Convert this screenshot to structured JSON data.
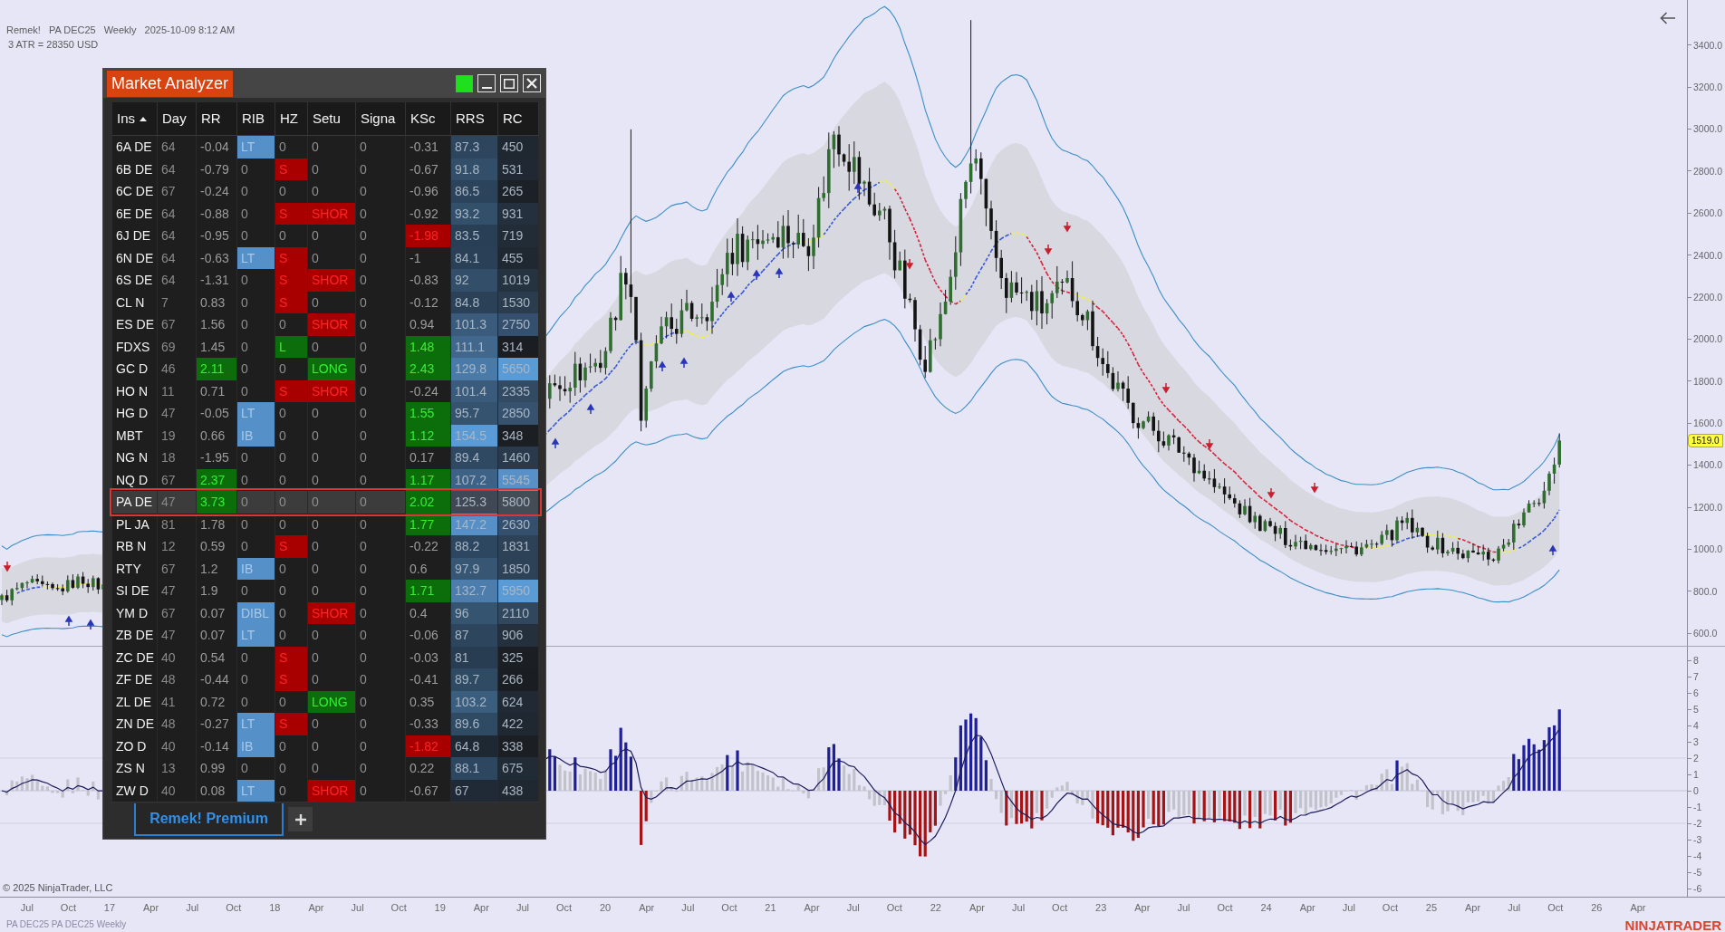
{
  "chart_header": {
    "parts": [
      "Remek!",
      "PA DEC25",
      "Weekly",
      "2025-10-09 8:12 AM"
    ],
    "atr": "3 ATR = 28350 USD"
  },
  "price_axis": {
    "labels": [
      "3400.0",
      "3200.0",
      "3000.0",
      "2800.0",
      "2600.0",
      "2400.0",
      "2200.0",
      "2000.0",
      "1800.0",
      "1600.0",
      "1400.0",
      "1200.0",
      "1000.0",
      "800.0",
      "600.0"
    ],
    "last_price": "1519.0"
  },
  "oscillator_axis": {
    "labels": [
      "8",
      "7",
      "6",
      "5",
      "4",
      "3",
      "2",
      "1",
      "0",
      "-1",
      "-2",
      "-3",
      "-4",
      "-5",
      "-6"
    ]
  },
  "time_axis": {
    "labels": [
      "Jul",
      "Oct",
      "17",
      "Apr",
      "Jul",
      "Oct",
      "18",
      "Apr",
      "Jul",
      "Oct",
      "19",
      "Apr",
      "Jul",
      "Oct",
      "20",
      "Apr",
      "Jul",
      "Oct",
      "21",
      "Apr",
      "Jul",
      "Oct",
      "22",
      "Apr",
      "Jul",
      "Oct",
      "23",
      "Apr",
      "Jul",
      "Oct",
      "24",
      "Apr",
      "Jul",
      "Oct",
      "25",
      "Apr",
      "Jul",
      "Oct",
      "26",
      "Apr"
    ]
  },
  "copyright": "© 2025 NinjaTrader, LLC",
  "chart_caption": "PA DEC25 PA DEC25 Weekly",
  "logo": "NINJATRADER",
  "market_analyzer": {
    "title": "Market Analyzer",
    "columns": [
      {
        "label": "Ins",
        "sorted": true
      },
      {
        "label": "Day",
        "sorted": false
      },
      {
        "label": "RR",
        "sorted": false
      },
      {
        "label": "RIB",
        "sorted": false
      },
      {
        "label": "HZ",
        "sorted": false
      },
      {
        "label": "Setu",
        "sorted": false
      },
      {
        "label": "Signa",
        "sorted": false
      },
      {
        "label": "KSc",
        "sorted": false
      },
      {
        "label": "RRS",
        "sorted": false
      },
      {
        "label": "RC",
        "sorted": false
      }
    ],
    "rows": [
      {
        "selected": false,
        "cells": [
          {
            "text": "6A DE",
            "kind": "plain"
          },
          {
            "text": "64",
            "kind": "plain"
          },
          {
            "text": "-0.04",
            "kind": "plain"
          },
          {
            "text": "LT",
            "kind": "band"
          },
          {
            "text": "0",
            "kind": "plain"
          },
          {
            "text": "0",
            "kind": "plain"
          },
          {
            "text": "0",
            "kind": "plain"
          },
          {
            "text": "-0.31",
            "kind": "plain"
          },
          {
            "text": "87.3",
            "kind": "heat",
            "color": "#2d455d"
          },
          {
            "text": "450",
            "kind": "heat",
            "color": "#1f2731"
          }
        ]
      },
      {
        "selected": false,
        "cells": [
          {
            "text": "6B DE",
            "kind": "plain"
          },
          {
            "text": "64",
            "kind": "plain"
          },
          {
            "text": "-0.79",
            "kind": "plain"
          },
          {
            "text": "0",
            "kind": "plain"
          },
          {
            "text": "S",
            "kind": "short"
          },
          {
            "text": "0",
            "kind": "plain"
          },
          {
            "text": "0",
            "kind": "plain"
          },
          {
            "text": "-0.67",
            "kind": "plain"
          },
          {
            "text": "91.8",
            "kind": "heat",
            "color": "#324e69"
          },
          {
            "text": "531",
            "kind": "heat",
            "color": "#202933"
          }
        ]
      },
      {
        "selected": false,
        "cells": [
          {
            "text": "6C DE",
            "kind": "plain"
          },
          {
            "text": "67",
            "kind": "plain"
          },
          {
            "text": "-0.24",
            "kind": "plain"
          },
          {
            "text": "0",
            "kind": "plain"
          },
          {
            "text": "0",
            "kind": "plain"
          },
          {
            "text": "0",
            "kind": "plain"
          },
          {
            "text": "0",
            "kind": "plain"
          },
          {
            "text": "-0.96",
            "kind": "plain"
          },
          {
            "text": "86.5",
            "kind": "heat",
            "color": "#2c445b"
          },
          {
            "text": "265",
            "kind": "heat",
            "color": "#1c2128"
          }
        ]
      },
      {
        "selected": false,
        "cells": [
          {
            "text": "6E DE",
            "kind": "plain"
          },
          {
            "text": "64",
            "kind": "plain"
          },
          {
            "text": "-0.88",
            "kind": "plain"
          },
          {
            "text": "0",
            "kind": "plain"
          },
          {
            "text": "S",
            "kind": "short"
          },
          {
            "text": "SHOR",
            "kind": "short"
          },
          {
            "text": "0",
            "kind": "plain"
          },
          {
            "text": "-0.92",
            "kind": "plain"
          },
          {
            "text": "93.2",
            "kind": "heat",
            "color": "#33506b"
          },
          {
            "text": "931",
            "kind": "heat",
            "color": "#24303d"
          }
        ]
      },
      {
        "selected": false,
        "cells": [
          {
            "text": "6J DE",
            "kind": "plain"
          },
          {
            "text": "64",
            "kind": "plain"
          },
          {
            "text": "-0.95",
            "kind": "plain"
          },
          {
            "text": "0",
            "kind": "plain"
          },
          {
            "text": "0",
            "kind": "plain"
          },
          {
            "text": "0",
            "kind": "plain"
          },
          {
            "text": "0",
            "kind": "plain"
          },
          {
            "text": "-1.98",
            "kind": "short"
          },
          {
            "text": "83.5",
            "kind": "heat",
            "color": "#293f55"
          },
          {
            "text": "719",
            "kind": "heat",
            "color": "#222c37"
          }
        ]
      },
      {
        "selected": false,
        "cells": [
          {
            "text": "6N DE",
            "kind": "plain"
          },
          {
            "text": "64",
            "kind": "plain"
          },
          {
            "text": "-0.63",
            "kind": "plain"
          },
          {
            "text": "LT",
            "kind": "band"
          },
          {
            "text": "S",
            "kind": "short"
          },
          {
            "text": "0",
            "kind": "plain"
          },
          {
            "text": "0",
            "kind": "plain"
          },
          {
            "text": "-1",
            "kind": "plain"
          },
          {
            "text": "84.1",
            "kind": "heat",
            "color": "#2a4056"
          },
          {
            "text": "455",
            "kind": "heat",
            "color": "#1f2731"
          }
        ]
      },
      {
        "selected": false,
        "cells": [
          {
            "text": "6S DE",
            "kind": "plain"
          },
          {
            "text": "64",
            "kind": "plain"
          },
          {
            "text": "-1.31",
            "kind": "plain"
          },
          {
            "text": "0",
            "kind": "plain"
          },
          {
            "text": "S",
            "kind": "short"
          },
          {
            "text": "SHOR",
            "kind": "short"
          },
          {
            "text": "0",
            "kind": "plain"
          },
          {
            "text": "-0.83",
            "kind": "plain"
          },
          {
            "text": "92",
            "kind": "heat",
            "color": "#324e69"
          },
          {
            "text": "1019",
            "kind": "heat",
            "color": "#25323f"
          }
        ]
      },
      {
        "selected": false,
        "cells": [
          {
            "text": "CL N",
            "kind": "plain"
          },
          {
            "text": "7",
            "kind": "plain"
          },
          {
            "text": "0.83",
            "kind": "plain"
          },
          {
            "text": "0",
            "kind": "plain"
          },
          {
            "text": "S",
            "kind": "short"
          },
          {
            "text": "0",
            "kind": "plain"
          },
          {
            "text": "0",
            "kind": "plain"
          },
          {
            "text": "-0.12",
            "kind": "plain"
          },
          {
            "text": "84.8",
            "kind": "heat",
            "color": "#2a4157"
          },
          {
            "text": "1530",
            "kind": "heat",
            "color": "#2b3c4e"
          }
        ]
      },
      {
        "selected": false,
        "cells": [
          {
            "text": "ES DE",
            "kind": "plain"
          },
          {
            "text": "67",
            "kind": "plain"
          },
          {
            "text": "1.56",
            "kind": "plain"
          },
          {
            "text": "0",
            "kind": "plain"
          },
          {
            "text": "0",
            "kind": "plain"
          },
          {
            "text": "SHOR",
            "kind": "short"
          },
          {
            "text": "0",
            "kind": "plain"
          },
          {
            "text": "0.94",
            "kind": "plain"
          },
          {
            "text": "101.3",
            "kind": "heat",
            "color": "#3a5b7b"
          },
          {
            "text": "2750",
            "kind": "heat",
            "color": "#34506e"
          }
        ]
      },
      {
        "selected": false,
        "cells": [
          {
            "text": "FDXS",
            "kind": "plain"
          },
          {
            "text": "69",
            "kind": "plain"
          },
          {
            "text": "1.45",
            "kind": "plain"
          },
          {
            "text": "0",
            "kind": "plain"
          },
          {
            "text": "L",
            "kind": "long"
          },
          {
            "text": "0",
            "kind": "plain"
          },
          {
            "text": "0",
            "kind": "plain"
          },
          {
            "text": "1.48",
            "kind": "long"
          },
          {
            "text": "111.1",
            "kind": "heat",
            "color": "#41678d"
          },
          {
            "text": "314",
            "kind": "heat",
            "color": "#1a1d21"
          }
        ]
      },
      {
        "selected": false,
        "cells": [
          {
            "text": "GC D",
            "kind": "plain"
          },
          {
            "text": "46",
            "kind": "plain"
          },
          {
            "text": "2.11",
            "kind": "long"
          },
          {
            "text": "0",
            "kind": "plain"
          },
          {
            "text": "0",
            "kind": "plain"
          },
          {
            "text": "LONG",
            "kind": "long"
          },
          {
            "text": "0",
            "kind": "plain"
          },
          {
            "text": "2.43",
            "kind": "long"
          },
          {
            "text": "129.8",
            "kind": "heat",
            "color": "#4a7aa8"
          },
          {
            "text": "5650",
            "kind": "heat",
            "color": "#5b9bd5"
          }
        ]
      },
      {
        "selected": false,
        "cells": [
          {
            "text": "HO N",
            "kind": "plain"
          },
          {
            "text": "11",
            "kind": "plain"
          },
          {
            "text": "0.71",
            "kind": "plain"
          },
          {
            "text": "0",
            "kind": "plain"
          },
          {
            "text": "S",
            "kind": "short"
          },
          {
            "text": "SHOR",
            "kind": "short"
          },
          {
            "text": "0",
            "kind": "plain"
          },
          {
            "text": "-0.24",
            "kind": "plain"
          },
          {
            "text": "101.4",
            "kind": "heat",
            "color": "#3a5b7b"
          },
          {
            "text": "2335",
            "kind": "heat",
            "color": "#324a62"
          }
        ]
      },
      {
        "selected": false,
        "cells": [
          {
            "text": "HG D",
            "kind": "plain"
          },
          {
            "text": "47",
            "kind": "plain"
          },
          {
            "text": "-0.05",
            "kind": "plain"
          },
          {
            "text": "LT",
            "kind": "band"
          },
          {
            "text": "0",
            "kind": "plain"
          },
          {
            "text": "0",
            "kind": "plain"
          },
          {
            "text": "0",
            "kind": "plain"
          },
          {
            "text": "1.55",
            "kind": "long"
          },
          {
            "text": "95.7",
            "kind": "heat",
            "color": "#35536f"
          },
          {
            "text": "2850",
            "kind": "heat",
            "color": "#36526f"
          }
        ]
      },
      {
        "selected": false,
        "cells": [
          {
            "text": "MBT",
            "kind": "plain"
          },
          {
            "text": "19",
            "kind": "plain"
          },
          {
            "text": "0.66",
            "kind": "plain"
          },
          {
            "text": "IB",
            "kind": "band"
          },
          {
            "text": "0",
            "kind": "plain"
          },
          {
            "text": "0",
            "kind": "plain"
          },
          {
            "text": "0",
            "kind": "plain"
          },
          {
            "text": "1.12",
            "kind": "long"
          },
          {
            "text": "154.5",
            "kind": "heat",
            "color": "#5b9bd5"
          },
          {
            "text": "348",
            "kind": "heat",
            "color": "#1b1e22"
          }
        ]
      },
      {
        "selected": false,
        "cells": [
          {
            "text": "NG N",
            "kind": "plain"
          },
          {
            "text": "18",
            "kind": "plain"
          },
          {
            "text": "-1.95",
            "kind": "plain"
          },
          {
            "text": "0",
            "kind": "plain"
          },
          {
            "text": "0",
            "kind": "plain"
          },
          {
            "text": "0",
            "kind": "plain"
          },
          {
            "text": "0",
            "kind": "plain"
          },
          {
            "text": "0.17",
            "kind": "plain"
          },
          {
            "text": "89.4",
            "kind": "heat",
            "color": "#2f4962"
          },
          {
            "text": "1460",
            "kind": "heat",
            "color": "#2a3a4c"
          }
        ]
      },
      {
        "selected": false,
        "cells": [
          {
            "text": "NQ D",
            "kind": "plain"
          },
          {
            "text": "67",
            "kind": "plain"
          },
          {
            "text": "2.37",
            "kind": "long"
          },
          {
            "text": "0",
            "kind": "plain"
          },
          {
            "text": "0",
            "kind": "plain"
          },
          {
            "text": "0",
            "kind": "plain"
          },
          {
            "text": "0",
            "kind": "plain"
          },
          {
            "text": "1.17",
            "kind": "long"
          },
          {
            "text": "107.2",
            "kind": "heat",
            "color": "#3e6286"
          },
          {
            "text": "5545",
            "kind": "heat",
            "color": "#5890c8"
          }
        ]
      },
      {
        "selected": true,
        "cells": [
          {
            "text": "PA DE",
            "kind": "plain"
          },
          {
            "text": "47",
            "kind": "plain"
          },
          {
            "text": "3.73",
            "kind": "long"
          },
          {
            "text": "0",
            "kind": "plain"
          },
          {
            "text": "0",
            "kind": "plain"
          },
          {
            "text": "0",
            "kind": "plain"
          },
          {
            "text": "0",
            "kind": "plain"
          },
          {
            "text": "2.02",
            "kind": "long"
          },
          {
            "text": "125.3",
            "kind": "heat",
            "color": "#3f4854"
          },
          {
            "text": "5800",
            "kind": "heat",
            "color": "#444c56"
          }
        ]
      },
      {
        "selected": false,
        "cells": [
          {
            "text": "PL JA",
            "kind": "plain"
          },
          {
            "text": "81",
            "kind": "plain"
          },
          {
            "text": "1.78",
            "kind": "plain"
          },
          {
            "text": "0",
            "kind": "plain"
          },
          {
            "text": "0",
            "kind": "plain"
          },
          {
            "text": "0",
            "kind": "plain"
          },
          {
            "text": "0",
            "kind": "plain"
          },
          {
            "text": "1.77",
            "kind": "long"
          },
          {
            "text": "147.2",
            "kind": "heat",
            "color": "#5690c6"
          },
          {
            "text": "2630",
            "kind": "heat",
            "color": "#34506c"
          }
        ]
      },
      {
        "selected": false,
        "cells": [
          {
            "text": "RB N",
            "kind": "plain"
          },
          {
            "text": "12",
            "kind": "plain"
          },
          {
            "text": "0.59",
            "kind": "plain"
          },
          {
            "text": "0",
            "kind": "plain"
          },
          {
            "text": "S",
            "kind": "short"
          },
          {
            "text": "0",
            "kind": "plain"
          },
          {
            "text": "0",
            "kind": "plain"
          },
          {
            "text": "-0.22",
            "kind": "plain"
          },
          {
            "text": "88.2",
            "kind": "heat",
            "color": "#2e4760"
          },
          {
            "text": "1831",
            "kind": "heat",
            "color": "#2d4256"
          }
        ]
      },
      {
        "selected": false,
        "cells": [
          {
            "text": "RTY",
            "kind": "plain"
          },
          {
            "text": "67",
            "kind": "plain"
          },
          {
            "text": "1.2",
            "kind": "plain"
          },
          {
            "text": "IB",
            "kind": "band"
          },
          {
            "text": "0",
            "kind": "plain"
          },
          {
            "text": "0",
            "kind": "plain"
          },
          {
            "text": "0",
            "kind": "plain"
          },
          {
            "text": "0.6",
            "kind": "plain"
          },
          {
            "text": "97.9",
            "kind": "heat",
            "color": "#365674"
          },
          {
            "text": "1850",
            "kind": "heat",
            "color": "#2d4256"
          }
        ]
      },
      {
        "selected": false,
        "cells": [
          {
            "text": "SI DE",
            "kind": "plain"
          },
          {
            "text": "47",
            "kind": "plain"
          },
          {
            "text": "1.9",
            "kind": "plain"
          },
          {
            "text": "0",
            "kind": "plain"
          },
          {
            "text": "0",
            "kind": "plain"
          },
          {
            "text": "0",
            "kind": "plain"
          },
          {
            "text": "0",
            "kind": "plain"
          },
          {
            "text": "1.71",
            "kind": "long"
          },
          {
            "text": "132.7",
            "kind": "heat",
            "color": "#4c7dad"
          },
          {
            "text": "5950",
            "kind": "heat",
            "color": "#5b9bd5"
          }
        ]
      },
      {
        "selected": false,
        "cells": [
          {
            "text": "YM D",
            "kind": "plain"
          },
          {
            "text": "67",
            "kind": "plain"
          },
          {
            "text": "0.07",
            "kind": "plain"
          },
          {
            "text": "DIBL",
            "kind": "band"
          },
          {
            "text": "0",
            "kind": "plain"
          },
          {
            "text": "SHOR",
            "kind": "short"
          },
          {
            "text": "0",
            "kind": "plain"
          },
          {
            "text": "0.4",
            "kind": "plain"
          },
          {
            "text": "96",
            "kind": "heat",
            "color": "#355470"
          },
          {
            "text": "2110",
            "kind": "heat",
            "color": "#30475e"
          }
        ]
      },
      {
        "selected": false,
        "cells": [
          {
            "text": "ZB DE",
            "kind": "plain"
          },
          {
            "text": "47",
            "kind": "plain"
          },
          {
            "text": "0.07",
            "kind": "plain"
          },
          {
            "text": "LT",
            "kind": "band"
          },
          {
            "text": "0",
            "kind": "plain"
          },
          {
            "text": "0",
            "kind": "plain"
          },
          {
            "text": "0",
            "kind": "plain"
          },
          {
            "text": "-0.06",
            "kind": "plain"
          },
          {
            "text": "87",
            "kind": "heat",
            "color": "#2d455d"
          },
          {
            "text": "906",
            "kind": "heat",
            "color": "#24303c"
          }
        ]
      },
      {
        "selected": false,
        "cells": [
          {
            "text": "ZC DE",
            "kind": "plain"
          },
          {
            "text": "40",
            "kind": "plain"
          },
          {
            "text": "0.54",
            "kind": "plain"
          },
          {
            "text": "0",
            "kind": "plain"
          },
          {
            "text": "S",
            "kind": "short"
          },
          {
            "text": "0",
            "kind": "plain"
          },
          {
            "text": "0",
            "kind": "plain"
          },
          {
            "text": "-0.03",
            "kind": "plain"
          },
          {
            "text": "81",
            "kind": "heat",
            "color": "#283d52"
          },
          {
            "text": "325",
            "kind": "heat",
            "color": "#1b1f24"
          }
        ]
      },
      {
        "selected": false,
        "cells": [
          {
            "text": "ZF DE",
            "kind": "plain"
          },
          {
            "text": "48",
            "kind": "plain"
          },
          {
            "text": "-0.44",
            "kind": "plain"
          },
          {
            "text": "0",
            "kind": "plain"
          },
          {
            "text": "S",
            "kind": "short"
          },
          {
            "text": "0",
            "kind": "plain"
          },
          {
            "text": "0",
            "kind": "plain"
          },
          {
            "text": "-0.41",
            "kind": "plain"
          },
          {
            "text": "89.7",
            "kind": "heat",
            "color": "#2f4a63"
          },
          {
            "text": "266",
            "kind": "heat",
            "color": "#1a1e22"
          }
        ]
      },
      {
        "selected": false,
        "cells": [
          {
            "text": "ZL DE",
            "kind": "plain"
          },
          {
            "text": "41",
            "kind": "plain"
          },
          {
            "text": "0.72",
            "kind": "plain"
          },
          {
            "text": "0",
            "kind": "plain"
          },
          {
            "text": "0",
            "kind": "plain"
          },
          {
            "text": "LONG",
            "kind": "long"
          },
          {
            "text": "0",
            "kind": "plain"
          },
          {
            "text": "0.35",
            "kind": "plain"
          },
          {
            "text": "103.2",
            "kind": "heat",
            "color": "#3b5d7e"
          },
          {
            "text": "624",
            "kind": "heat",
            "color": "#212a34"
          }
        ]
      },
      {
        "selected": false,
        "cells": [
          {
            "text": "ZN DE",
            "kind": "plain"
          },
          {
            "text": "48",
            "kind": "plain"
          },
          {
            "text": "-0.27",
            "kind": "plain"
          },
          {
            "text": "LT",
            "kind": "band"
          },
          {
            "text": "S",
            "kind": "short"
          },
          {
            "text": "0",
            "kind": "plain"
          },
          {
            "text": "0",
            "kind": "plain"
          },
          {
            "text": "-0.33",
            "kind": "plain"
          },
          {
            "text": "89.6",
            "kind": "heat",
            "color": "#2f4a63"
          },
          {
            "text": "422",
            "kind": "heat",
            "color": "#1f2731"
          }
        ]
      },
      {
        "selected": false,
        "cells": [
          {
            "text": "ZO D",
            "kind": "plain"
          },
          {
            "text": "40",
            "kind": "plain"
          },
          {
            "text": "-0.14",
            "kind": "plain"
          },
          {
            "text": "IB",
            "kind": "band"
          },
          {
            "text": "0",
            "kind": "plain"
          },
          {
            "text": "0",
            "kind": "plain"
          },
          {
            "text": "0",
            "kind": "plain"
          },
          {
            "text": "-1.82",
            "kind": "short"
          },
          {
            "text": "64.8",
            "kind": "heat",
            "color": "#1e2833"
          },
          {
            "text": "338",
            "kind": "heat",
            "color": "#1b1f24"
          }
        ]
      },
      {
        "selected": false,
        "cells": [
          {
            "text": "ZS N",
            "kind": "plain"
          },
          {
            "text": "13",
            "kind": "plain"
          },
          {
            "text": "0.99",
            "kind": "plain"
          },
          {
            "text": "0",
            "kind": "plain"
          },
          {
            "text": "0",
            "kind": "plain"
          },
          {
            "text": "0",
            "kind": "plain"
          },
          {
            "text": "0",
            "kind": "plain"
          },
          {
            "text": "0.22",
            "kind": "plain"
          },
          {
            "text": "88.1",
            "kind": "heat",
            "color": "#2e4760"
          },
          {
            "text": "675",
            "kind": "heat",
            "color": "#212b35"
          }
        ]
      },
      {
        "selected": false,
        "cells": [
          {
            "text": "ZW D",
            "kind": "plain"
          },
          {
            "text": "40",
            "kind": "plain"
          },
          {
            "text": "0.08",
            "kind": "plain"
          },
          {
            "text": "LT",
            "kind": "band"
          },
          {
            "text": "0",
            "kind": "plain"
          },
          {
            "text": "SHOR",
            "kind": "short"
          },
          {
            "text": "0",
            "kind": "plain"
          },
          {
            "text": "-0.67",
            "kind": "plain"
          },
          {
            "text": "67",
            "kind": "heat",
            "color": "#1f2a36"
          },
          {
            "text": "438",
            "kind": "heat",
            "color": "#1f2731"
          }
        ]
      }
    ],
    "tabs": [
      {
        "label": "Remek! Premium",
        "selected": true
      }
    ]
  }
}
